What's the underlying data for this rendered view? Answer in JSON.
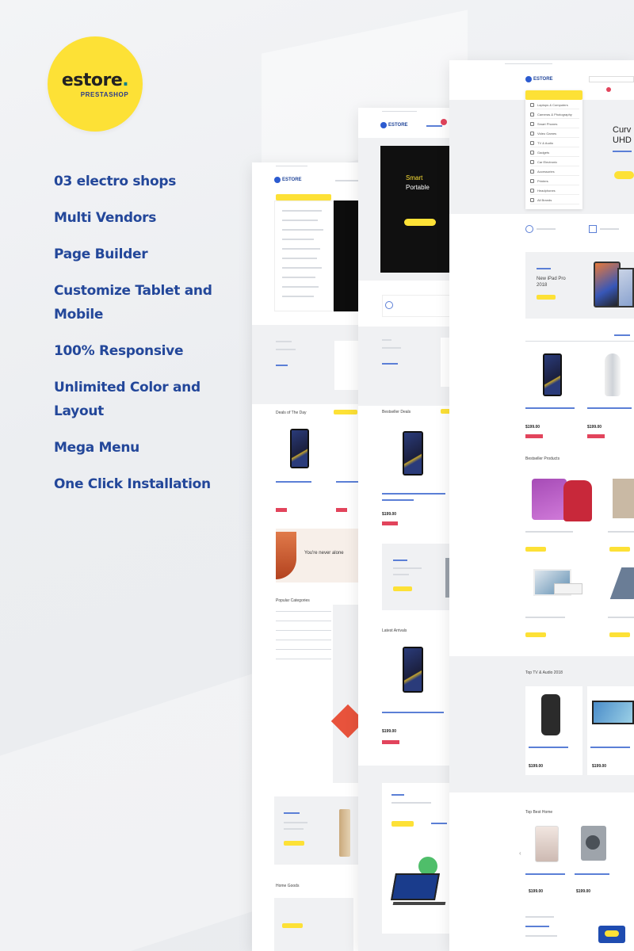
{
  "logo": {
    "word": "estore",
    "dot": ".",
    "sub": "PRESTASHOP"
  },
  "features": [
    "03 electro shops",
    "Multi Vendors",
    "Page Builder",
    "Customize Tablet and Mobile",
    "100% Responsive",
    "Unlimited Color and Layout",
    "Mega Menu",
    "One Click Installation"
  ],
  "preview_right": {
    "hero_text": "Curv\nUHD T",
    "promo_title": "New iPad Pro 2018",
    "section_trends": "Bestseller Products",
    "section_top": "Top TV & Audio 2018",
    "section_bottom": "Top Best Home",
    "price_1": "$199.00",
    "price_2": "$199.00"
  },
  "preview_middle": {
    "hero_line1": "Smart",
    "hero_line2": "Portable"
  },
  "colors": {
    "accent_yellow": "#fde136",
    "brand_blue": "#23479a",
    "sale_red": "#e2445c"
  }
}
